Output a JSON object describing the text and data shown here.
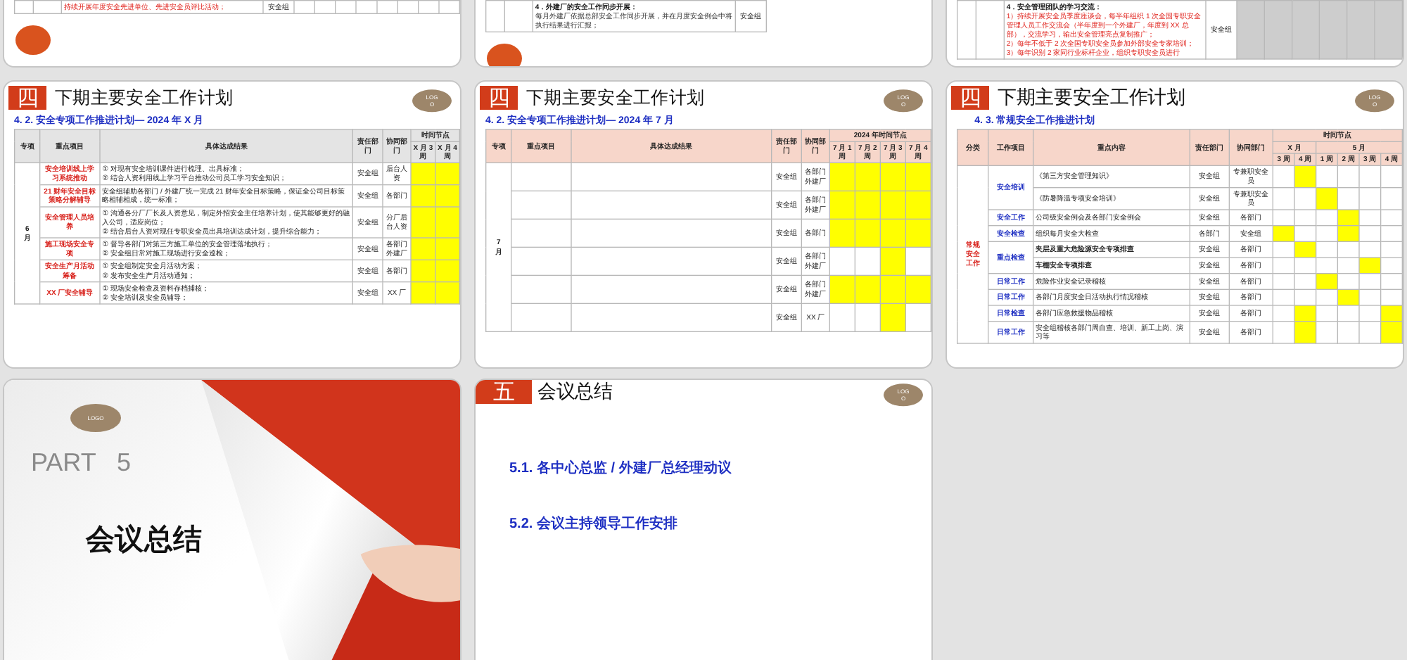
{
  "previous_slides": [
    {
      "kind": "table_tail",
      "lines": [
        {
          "kind": "red",
          "text": "持续开展年度安全先进单位、先进安全员评比活动；"
        }
      ],
      "owner": "安全组",
      "weeks": [
        false,
        false,
        false,
        false,
        false,
        false,
        false,
        false
      ]
    },
    {
      "kind": "table_tail",
      "lines": [
        {
          "kind": "heading",
          "text": "4．外建厂的安全工作同步开展："
        },
        {
          "kind": "plain",
          "text": "每月外建厂依据总部安全工作同步开展，并在月度安全例会中将执行结果进行汇报；"
        }
      ],
      "owner": "安全组"
    },
    {
      "kind": "table_tail",
      "lines": [
        {
          "kind": "heading",
          "text": "4．安全管理团队的学习交流："
        },
        {
          "kind": "red",
          "text": "1）持续开展安全员季度座谈会，每半年组织 1 次全国专职安全管理人员工作交流会（半年度到一个外建厂，年度到 XX 总部），交流学习，输出安全管理亮点复制推广；"
        },
        {
          "kind": "red",
          "text": "2）每年不低于 2 次全国专职安全员参加外部安全专家培训；"
        },
        {
          "kind": "red",
          "text": "3）每年识别 2 家同行业标杆企业，组织专职安全员进行"
        }
      ],
      "owner": "安全组",
      "shaded": true,
      "weeks": [
        false,
        false,
        false,
        false,
        false,
        false
      ]
    }
  ],
  "slides": [
    {
      "kind": "plan_table",
      "section_number": "四",
      "title": "下期主要安全工作计划",
      "logo": "LOGO",
      "subtitle": "4. 2.  安全专项工作推进计划— 2024 年 X 月",
      "columns": [
        "专项",
        "重点项目",
        "具体达成结果",
        "责任部门",
        "协同部门"
      ],
      "timeline": {
        "label": "时间节点",
        "weeks": [
          "X 月 3 周",
          "X 月 4 周"
        ]
      },
      "month": "6 月",
      "rows": [
        {
          "item": "安全培训线上学习系统推动",
          "details": [
            "① 对现有安全培训课件进行梳理、出具标准；",
            "② 结合人资利用线上学习平台推动公司员工学习安全知识；"
          ],
          "owner": "安全组",
          "partner": "后台人资",
          "weeks": [
            true,
            true
          ]
        },
        {
          "item": "21 财年安全目标策略分解辅导",
          "details": [
            "安全组辅助各部门 / 外建厂统一完成 21 财年安全目标策略，保证全公司目标策略相辅相成，统一标准；"
          ],
          "owner": "安全组",
          "partner": "各部门",
          "weeks": [
            true,
            true
          ]
        },
        {
          "item": "安全管理人员培养",
          "details": [
            "① 沟通各分厂厂长及人资意见，制定外招安全主任培养计划，使其能够更好的融入公司，适应岗位；",
            "② 结合后台人资对现任专职安全员出具培训达成计划，提升综合能力；"
          ],
          "owner": "安全组",
          "partner": "分厂后台人资",
          "weeks": [
            true,
            true
          ]
        },
        {
          "item": "施工现场安全专项",
          "details": [
            "① 督导各部门对第三方施工单位的安全管理落地执行；",
            "② 安全组日常对施工现场进行安全巡检；"
          ],
          "owner": "安全组",
          "partner": "各部门外建厂",
          "weeks": [
            true,
            true
          ]
        },
        {
          "item": "安全生产月活动筹备",
          "details": [
            "① 安全组制定安全月活动方案；",
            "② 发布安全生产月活动通知；"
          ],
          "owner": "安全组",
          "partner": "各部门",
          "weeks": [
            true,
            true
          ]
        },
        {
          "item": "XX 厂安全辅导",
          "details": [
            "① 现场安全检查及资料存档捕核；",
            "② 安全培训及安全员辅导；"
          ],
          "owner": "安全组",
          "partner": "XX 厂",
          "weeks": [
            true,
            true
          ]
        }
      ]
    },
    {
      "kind": "plan_table",
      "section_number": "四",
      "title": "下期主要安全工作计划",
      "logo": "LOGO",
      "subtitle": "4. 2.  安全专项工作推进计划— 2024 年 7 月",
      "columns": [
        "专项",
        "重点项目",
        "具体达成结果",
        "责任部门",
        "协同部门"
      ],
      "timeline": {
        "label": "2024 年时间节点",
        "weeks": [
          "7 月 1 周",
          "7 月 2 周",
          "7 月 3 周",
          "7 月 4 周"
        ]
      },
      "month": "7 月",
      "rows": [
        {
          "owner": "安全组",
          "partner": "各部门外建厂",
          "weeks": [
            true,
            true,
            true,
            true
          ]
        },
        {
          "owner": "安全组",
          "partner": "各部门外建厂",
          "weeks": [
            true,
            true,
            true,
            true
          ]
        },
        {
          "owner": "安全组",
          "partner": "各部门",
          "weeks": [
            true,
            true,
            true,
            true
          ]
        },
        {
          "owner": "安全组",
          "partner": "各部门外建厂",
          "weeks": [
            false,
            false,
            true,
            false
          ]
        },
        {
          "owner": "安全组",
          "partner": "各部门外建厂",
          "weeks": [
            true,
            true,
            true,
            true
          ]
        },
        {
          "owner": "安全组",
          "partner": "XX 厂",
          "weeks": [
            false,
            false,
            true,
            false
          ]
        }
      ]
    },
    {
      "kind": "routine_table",
      "section_number": "四",
      "title": "下期主要安全工作计划",
      "logo": "LOGO",
      "subtitle": "4. 3.  常规安全工作推进计划",
      "columns": [
        "分类",
        "工作项目",
        "重点内容",
        "责任部门",
        "协同部门"
      ],
      "timeline": {
        "label": "时间节点",
        "months": [
          {
            "label": "X 月",
            "weeks": [
              "3 周",
              "4 周"
            ]
          },
          {
            "label": "5 月",
            "weeks": [
              "1 周",
              "2 周",
              "3 周",
              "4 周"
            ]
          }
        ]
      },
      "category": "常规安全工作",
      "groups": [
        {
          "project": "安全培训",
          "rows": [
            {
              "content": "《第三方安全管理知识》",
              "emphasis": false,
              "owner": "安全组",
              "partner": "专兼职安全员",
              "weeks": [
                false,
                true,
                false,
                false,
                false,
                false
              ]
            },
            {
              "content": "《防暑降温专项安全培训》",
              "emphasis": false,
              "owner": "安全组",
              "partner": "专兼职安全员",
              "weeks": [
                false,
                false,
                true,
                false,
                false,
                false
              ]
            }
          ]
        },
        {
          "project": "安全工作",
          "rows": [
            {
              "content": "公司级安全例会及各部门安全例会",
              "emphasis": false,
              "owner": "安全组",
              "partner": "各部门",
              "weeks": [
                false,
                false,
                false,
                true,
                false,
                false
              ]
            }
          ]
        },
        {
          "project": "安全检查",
          "rows": [
            {
              "content": "组织每月安全大检查",
              "emphasis": false,
              "owner": "各部门",
              "partner": "安全组",
              "weeks": [
                true,
                false,
                false,
                true,
                false,
                false
              ]
            }
          ]
        },
        {
          "project": "重点检查",
          "rows": [
            {
              "content": "夹层及重大危险源安全专项排查",
              "emphasis": true,
              "owner": "安全组",
              "partner": "各部门",
              "weeks": [
                false,
                true,
                false,
                false,
                false,
                false
              ]
            },
            {
              "content": "车棚安全专项排查",
              "emphasis": true,
              "owner": "安全组",
              "partner": "各部门",
              "weeks": [
                false,
                false,
                false,
                false,
                true,
                false
              ]
            }
          ]
        },
        {
          "project": "日常工作",
          "rows": [
            {
              "content": "危险作业安全记录稽核",
              "emphasis": false,
              "owner": "安全组",
              "partner": "各部门",
              "weeks": [
                false,
                false,
                true,
                false,
                false,
                false
              ]
            }
          ]
        },
        {
          "project": "日常工作",
          "rows": [
            {
              "content": "各部门月度安全日活动执行情况稽核",
              "emphasis": false,
              "owner": "安全组",
              "partner": "各部门",
              "weeks": [
                false,
                false,
                false,
                true,
                false,
                false
              ]
            }
          ]
        },
        {
          "project": "日常检查",
          "rows": [
            {
              "content": "各部门应急救援物品稽核",
              "emphasis": false,
              "owner": "安全组",
              "partner": "各部门",
              "weeks": [
                false,
                true,
                false,
                false,
                false,
                true
              ]
            }
          ]
        },
        {
          "project": "日常工作",
          "rows": [
            {
              "content": "安全组稽核各部门周自查、培训、新工上岗、演习等",
              "emphasis": false,
              "owner": "安全组",
              "partner": "各部门",
              "weeks": [
                false,
                true,
                false,
                false,
                false,
                true
              ]
            }
          ]
        }
      ]
    },
    {
      "kind": "part_cover",
      "logo": "LOGO",
      "part": "PART   5",
      "title": "会议总结"
    },
    {
      "kind": "agenda",
      "section_number": "五",
      "title": "会议总结",
      "logo": "LOGO",
      "items": [
        "5.1.  各中心总监 / 外建厂总经理动议",
        "5.2. 会议主持领导工作安排"
      ]
    }
  ]
}
